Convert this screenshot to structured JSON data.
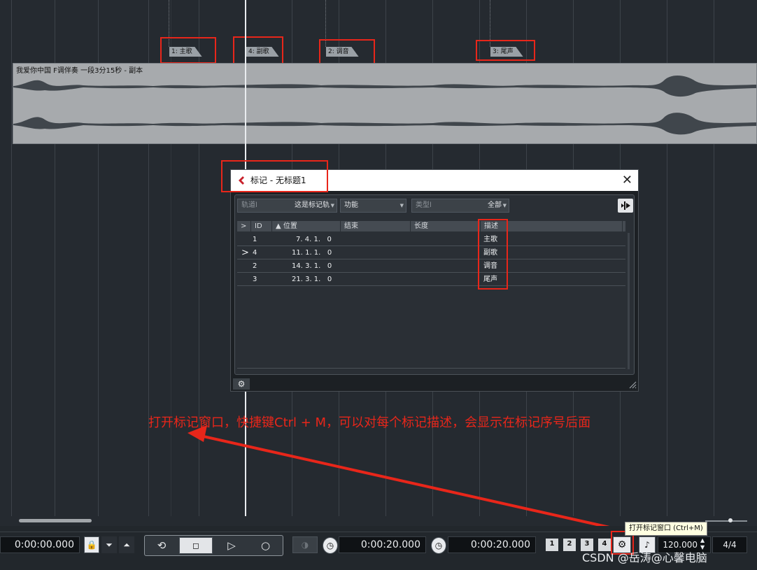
{
  "event": {
    "name": "我爱你中国 F调伴奏 一段3分15秒 - 副本"
  },
  "markers": [
    {
      "label": "1: 主歌"
    },
    {
      "label": "4: 副歌"
    },
    {
      "label": "2: 调音"
    },
    {
      "label": "3: 尾声"
    }
  ],
  "dialog": {
    "title": "标记 - 无标题1",
    "filters": {
      "track_placeholder": "轨道l",
      "track_value": "这是标记轨",
      "function": "功能",
      "type_placeholder": "类型l",
      "type_value": "全部"
    },
    "columns": [
      ">",
      "ID",
      "▲ 位置",
      "结束",
      "长度",
      "描述"
    ],
    "rows": [
      {
        "arrow": "",
        "id": "1",
        "position": "7. 4. 1.   0",
        "desc": "主歌"
      },
      {
        "arrow": ">",
        "id": "4",
        "position": "11. 1. 1.   0",
        "desc": "副歌"
      },
      {
        "arrow": "",
        "id": "2",
        "position": "14. 3. 1.   0",
        "desc": "调音"
      },
      {
        "arrow": "",
        "id": "3",
        "position": "21. 3. 1.   0",
        "desc": "尾声"
      }
    ]
  },
  "annotation": "打开标记窗口，快捷键Ctrl + M，可以对每个标记描述，会显示在标记序号后面",
  "transport": {
    "left_time": "0:00:00.000",
    "time_2": "0:00:20.000",
    "time_3": "0:00:20.000",
    "locators": [
      "1",
      "2",
      "3",
      "4"
    ],
    "tempo": "120.000",
    "signature": "4/4",
    "tooltip": "打开标记窗口 (Ctrl+M)"
  },
  "watermark": "CSDN @岳涛@心馨电脑",
  "colors": {
    "accent": "#e8261a",
    "background": "#252a30",
    "tooltip_bg": "#ffffe1"
  }
}
